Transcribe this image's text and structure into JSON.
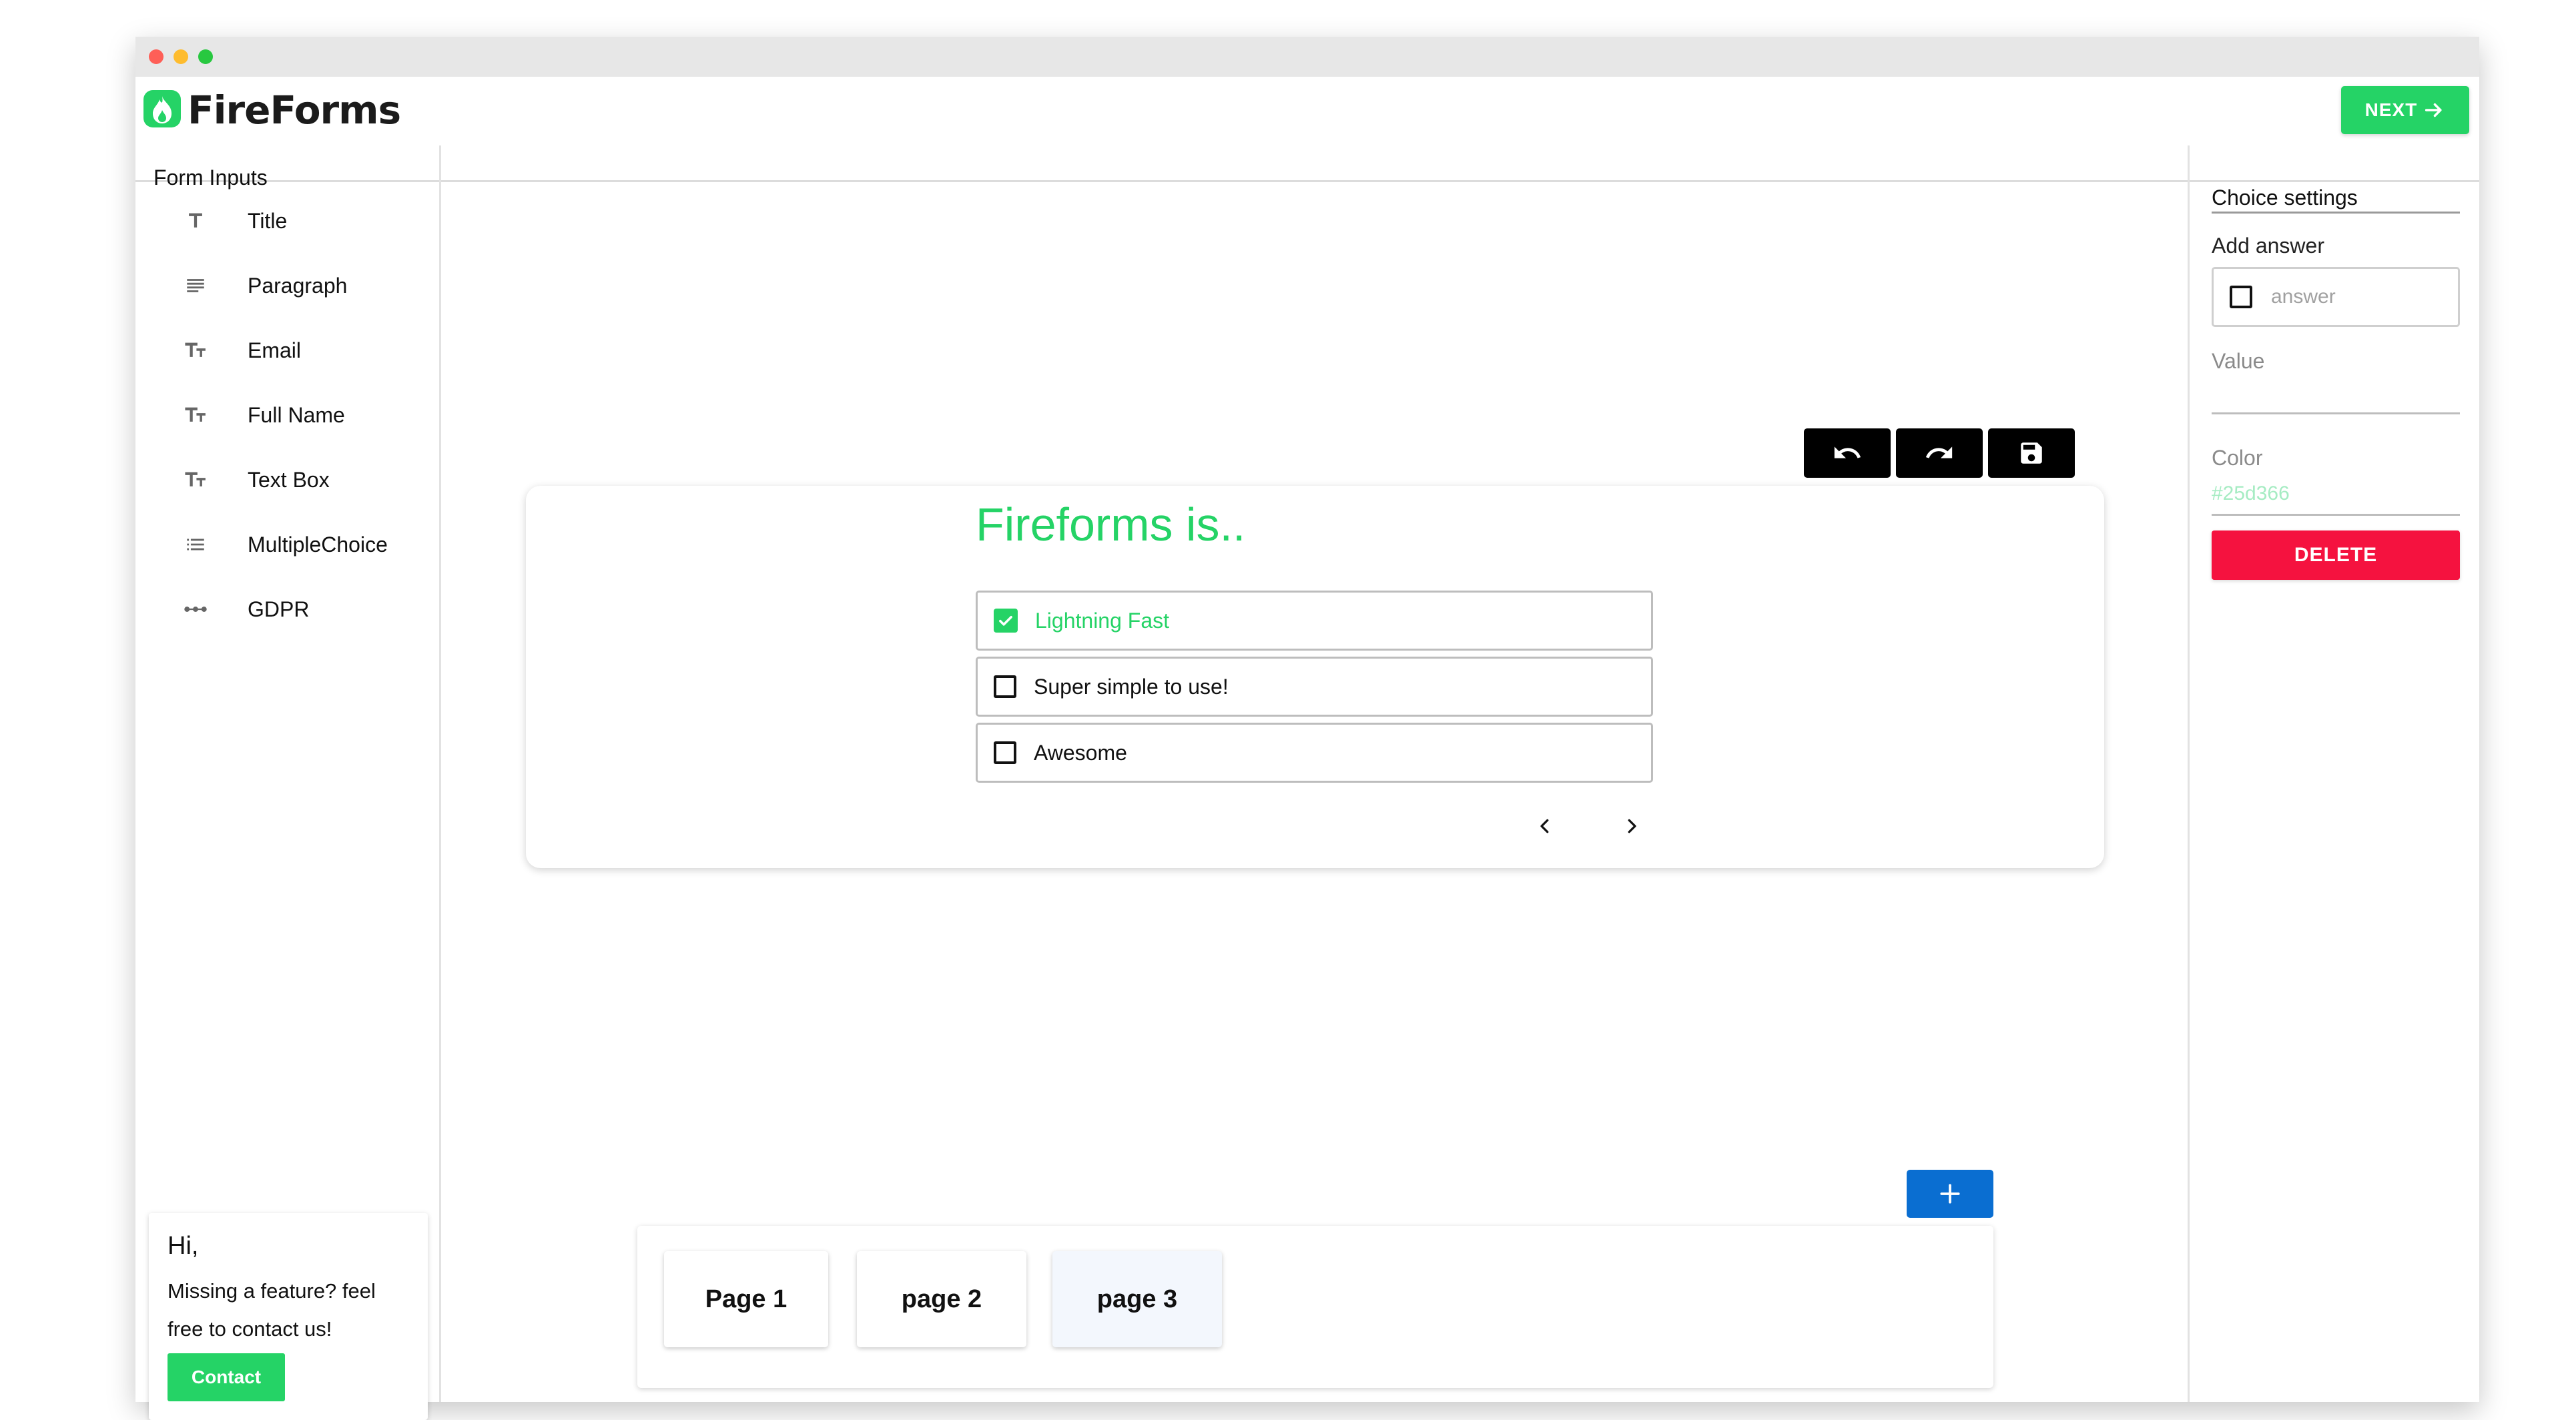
{
  "app": {
    "name": "FireForms"
  },
  "header": {
    "next_label": "NEXT"
  },
  "sidebar": {
    "title": "Form Inputs",
    "items": [
      {
        "label": "Title",
        "icon": "title-icon"
      },
      {
        "label": "Paragraph",
        "icon": "paragraph-icon"
      },
      {
        "label": "Email",
        "icon": "text-size-icon"
      },
      {
        "label": "Full Name",
        "icon": "text-size-icon"
      },
      {
        "label": "Text Box",
        "icon": "text-size-icon"
      },
      {
        "label": "MultipleChoice",
        "icon": "list-icon"
      },
      {
        "label": "GDPR",
        "icon": "linear-scale-icon"
      }
    ]
  },
  "contact_card": {
    "greeting": "Hi,",
    "message": "Missing a feature? feel free to contact us!",
    "button_label": "Contact"
  },
  "form": {
    "title": "Fireforms is..",
    "choices": [
      {
        "label": "Lightning Fast",
        "checked": true
      },
      {
        "label": "Super simple to use!",
        "checked": false
      },
      {
        "label": "Awesome",
        "checked": false
      }
    ]
  },
  "settings": {
    "title": "Choice settings",
    "add_answer_label": "Add answer",
    "answer_placeholder": "answer",
    "value_label": "Value",
    "color_label": "Color",
    "color_value": "#25d366",
    "delete_label": "DELETE"
  },
  "pages": {
    "tabs": [
      {
        "label": "Page 1"
      },
      {
        "label": "page 2"
      },
      {
        "label": "page 3",
        "active": true
      }
    ]
  },
  "colors": {
    "brand": "#25d366",
    "danger": "#f5123f",
    "primary": "#0a6ed1",
    "active_page": "#f3f7fd"
  }
}
